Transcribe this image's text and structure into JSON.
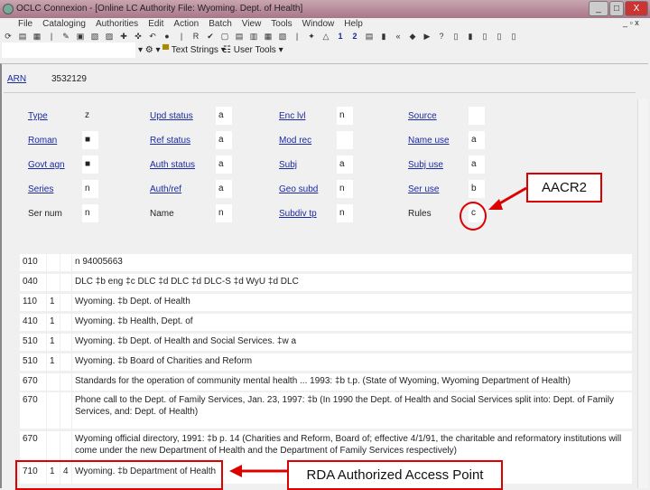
{
  "window": {
    "title": "OCLC Connexion - [Online LC Authority File: Wyoming. Dept. of Health]",
    "min": "_",
    "max": "□",
    "close": "X"
  },
  "menu": [
    "File",
    "Cataloging",
    "Authorities",
    "Edit",
    "Action",
    "Batch",
    "View",
    "Tools",
    "Window",
    "Help"
  ],
  "toolbar2": {
    "text_strings": "Text Strings",
    "user_tools": "User Tools"
  },
  "arn": {
    "label": "ARN",
    "value": "3532129"
  },
  "fixed_fields": [
    [
      {
        "l": "Type",
        "v": "z",
        "link": true
      },
      {
        "l": "Upd status",
        "v": "a",
        "link": true
      },
      {
        "l": "Enc lvl",
        "v": "n",
        "link": true
      },
      {
        "l": "Source",
        "v": "",
        "link": true
      }
    ],
    [
      {
        "l": "Roman",
        "v": "■",
        "link": true
      },
      {
        "l": "Ref status",
        "v": "a",
        "link": true
      },
      {
        "l": "Mod rec",
        "v": "",
        "link": true
      },
      {
        "l": "Name use",
        "v": "a",
        "link": true
      }
    ],
    [
      {
        "l": "Govt agn",
        "v": "■",
        "link": true
      },
      {
        "l": "Auth status",
        "v": "a",
        "link": true
      },
      {
        "l": "Subj",
        "v": "a",
        "link": true
      },
      {
        "l": "Subj use",
        "v": "a",
        "link": true
      }
    ],
    [
      {
        "l": "Series",
        "v": "n",
        "link": true
      },
      {
        "l": "Auth/ref",
        "v": "a",
        "link": true
      },
      {
        "l": "Geo subd",
        "v": "n",
        "link": true
      },
      {
        "l": "Ser use",
        "v": "b",
        "link": true
      }
    ],
    [
      {
        "l": "Ser num",
        "v": "n",
        "link": false
      },
      {
        "l": "Name",
        "v": "n",
        "link": false
      },
      {
        "l": "Subdiv tp",
        "v": "n",
        "link": true
      },
      {
        "l": "Rules",
        "v": "c",
        "link": false
      }
    ]
  ],
  "fields": [
    {
      "tag": "010",
      "i1": "",
      "i2": "",
      "text": "n 94005663"
    },
    {
      "tag": "040",
      "i1": "",
      "i2": "",
      "text": "DLC ‡b eng ‡c DLC ‡d DLC ‡d DLC-S ‡d WyU ‡d DLC"
    },
    {
      "tag": "110",
      "i1": "1",
      "i2": "",
      "text": "Wyoming. ‡b Dept. of Health"
    },
    {
      "tag": "410",
      "i1": "1",
      "i2": "",
      "text": "Wyoming. ‡b Health, Dept. of"
    },
    {
      "tag": "510",
      "i1": "1",
      "i2": "",
      "text": "Wyoming. ‡b Dept. of Health and Social Services. ‡w a"
    },
    {
      "tag": "510",
      "i1": "1",
      "i2": "",
      "text": "Wyoming. ‡b Board of Charities and Reform"
    },
    {
      "tag": "670",
      "i1": "",
      "i2": "",
      "text": "Standards for the operation of community mental health ... 1993: ‡b t.p. (State of Wyoming, Wyoming Department of Health)"
    },
    {
      "tag": "670",
      "i1": "",
      "i2": "",
      "text": "Phone call to the Dept. of Family Services, Jan. 23, 1997: ‡b (In 1990 the Dept. of Health and Social Services split into: Dept. of Family Services, and: Dept. of Health)"
    },
    {
      "tag": "670",
      "i1": "",
      "i2": "",
      "text": "Wyoming official directory, 1991: ‡b p. 14 (Charities and Reform, Board of; effective 4/1/91, the charitable and reformatory institutions will come under the new Department of Health and the Department of Family Services respectively)"
    },
    {
      "tag": "710",
      "i1": "1",
      "i2": "4",
      "text": "Wyoming. ‡b Department of Health"
    }
  ],
  "annotations": {
    "aacr2": "AACR2",
    "rda": "RDA Authorized Access Point"
  },
  "colors": {
    "annotation": "#d00000",
    "link": "#1a2aa0"
  }
}
